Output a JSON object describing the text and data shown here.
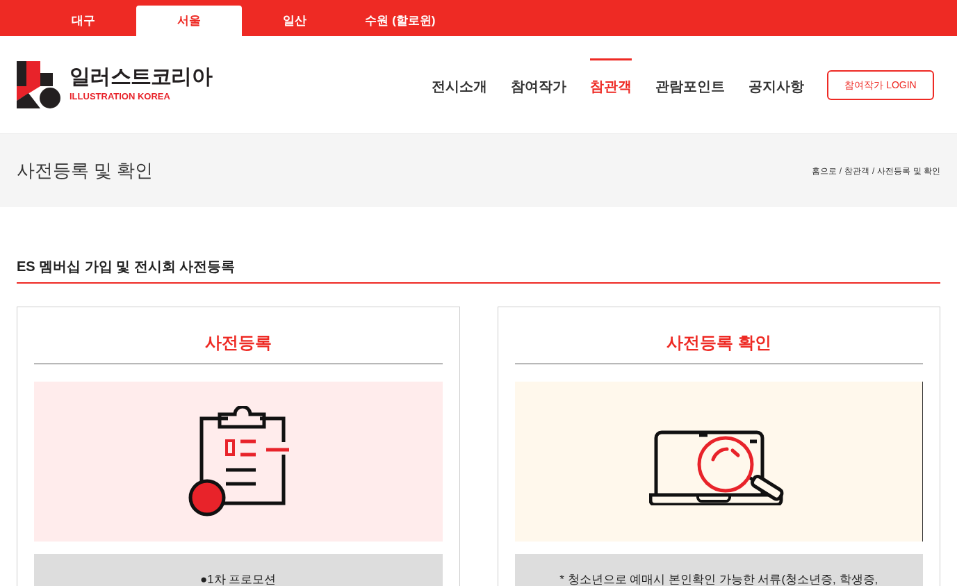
{
  "region_tabs": [
    {
      "label": "대구",
      "selected": false
    },
    {
      "label": "서울",
      "selected": true
    },
    {
      "label": "일산",
      "selected": false
    },
    {
      "label": "수원 (할로윈)",
      "selected": false
    }
  ],
  "logo": {
    "name": "일러스트코리아",
    "subtitle": "ILLUSTRATION KOREA"
  },
  "nav": [
    {
      "label": "전시소개",
      "selected": false
    },
    {
      "label": "참여작가",
      "selected": false
    },
    {
      "label": "참관객",
      "selected": true
    },
    {
      "label": "관람포인트",
      "selected": false
    },
    {
      "label": "공지사항",
      "selected": false
    }
  ],
  "login_button": "참여작가 LOGIN",
  "page_title": "사전등록 및 확인",
  "breadcrumb": [
    "홈으로",
    "참관객",
    "사전등록 및 확인"
  ],
  "breadcrumb_separator": "/",
  "section_title": "ES 멤버십 가입 및 전시회 사전등록",
  "cards": [
    {
      "kind": "clipboard",
      "title": "사전등록",
      "note": "●1차 프로모션"
    },
    {
      "kind": "laptop",
      "title": "사전등록 확인",
      "note": "* 청소년으로 예매시 본인확인 가능한 서류(청소년증, 학생증,"
    }
  ]
}
